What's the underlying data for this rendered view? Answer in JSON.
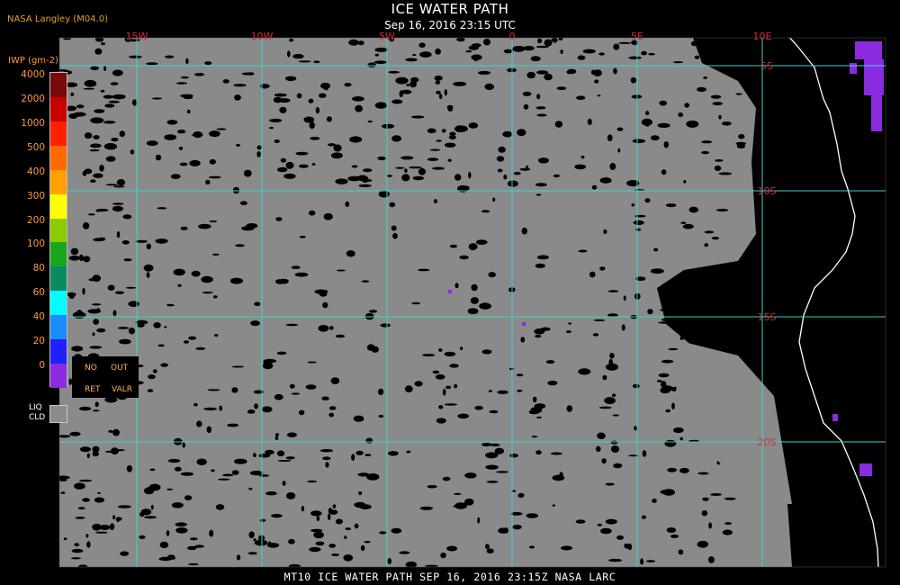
{
  "header": {
    "title": "ICE WATER PATH",
    "datetime": "Sep 16, 2016 23:15 UTC",
    "producer": "NASA Langley (M04.0)"
  },
  "legend": {
    "units": "IWP (gm-2)",
    "levels": [
      {
        "label": "4000",
        "color": "#7a0a0a"
      },
      {
        "label": "2000",
        "color": "#c80000"
      },
      {
        "label": "1000",
        "color": "#ff2000"
      },
      {
        "label": "500",
        "color": "#ff6a00"
      },
      {
        "label": "400",
        "color": "#ffa000"
      },
      {
        "label": "300",
        "color": "#ffff00"
      },
      {
        "label": "200",
        "color": "#8ccc00"
      },
      {
        "label": "100",
        "color": "#1aa51a"
      },
      {
        "label": "80",
        "color": "#0a8a60"
      },
      {
        "label": "60",
        "color": "#00ffff"
      },
      {
        "label": "40",
        "color": "#1a8cff"
      },
      {
        "label": "20",
        "color": "#2020ff"
      },
      {
        "label": "0",
        "color": "#8a2be2"
      }
    ],
    "no_retrieval": {
      "line1_a": "NO",
      "line1_b": "OUT",
      "line2_a": "RET",
      "line2_b": "VALR"
    },
    "liquid_cloud": {
      "line1": "LIQ",
      "line2": "CLD",
      "color": "#8c8c8c"
    }
  },
  "map": {
    "longitude_labels": [
      "15W",
      "10W",
      "5W",
      "0",
      "5E",
      "10E"
    ],
    "latitude_labels": [
      "5S",
      "10S",
      "15S",
      "20S"
    ],
    "grid_color": "#40d0d0",
    "label_color": "#d03030",
    "colors": {
      "ocean_cloud": "#8a8a8a",
      "clear": "#000000",
      "coast": "#ffffff",
      "ice": "#8a2be2"
    }
  },
  "footer": {
    "text": "MT10  ICE WATER PATH   SEP 16, 2016 23:15Z   NASA LARC"
  }
}
